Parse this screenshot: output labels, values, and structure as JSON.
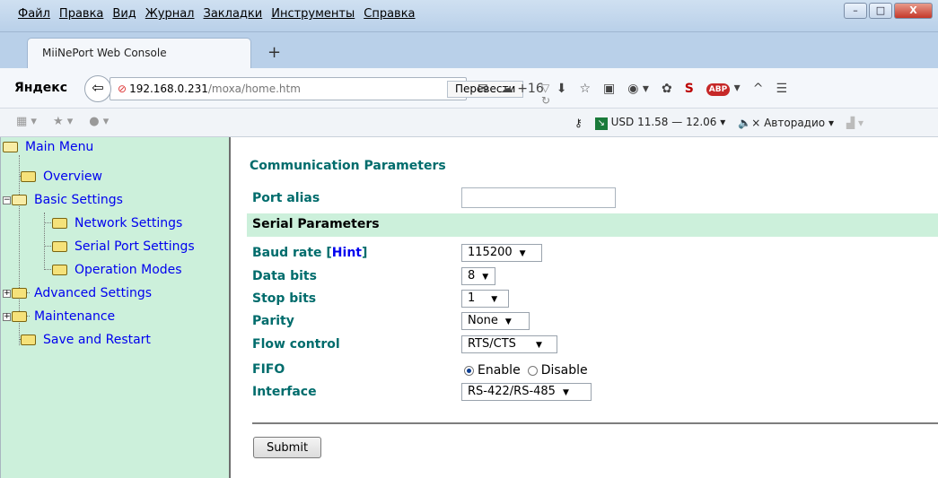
{
  "browser": {
    "menu": [
      "Файл",
      "Правка",
      "Вид",
      "Журнал",
      "Закладки",
      "Инструменты",
      "Справка"
    ],
    "tab_title": "MiiNePort Web Console",
    "new_tab": "+",
    "brand": "Яндекс",
    "url_host": "192.168.0.231",
    "url_path": "/moxa/home.htm",
    "translate_label": "Перевести",
    "weather": "+16",
    "currency": "USD 11.58 — 12.06",
    "radio": "Авторадио",
    "adblock": "ABP",
    "window_min": "–",
    "window_max": "□",
    "window_close": "X"
  },
  "sidebar": {
    "items": [
      {
        "label": "Main Menu"
      },
      {
        "label": "Overview"
      },
      {
        "label": "Basic Settings"
      },
      {
        "label": "Network Settings"
      },
      {
        "label": "Serial Port Settings"
      },
      {
        "label": "Operation Modes"
      },
      {
        "label": "Advanced Settings"
      },
      {
        "label": "Maintenance"
      },
      {
        "label": "Save and Restart"
      }
    ],
    "expand_minus": "−",
    "expand_plus": "+"
  },
  "main": {
    "title": "Communication Parameters",
    "port_alias_label": "Port alias",
    "port_alias_value": "",
    "section_title": "Serial Parameters",
    "baud_label": "Baud rate [",
    "hint_label": "Hint",
    "baud_close": "]",
    "baud_value": "115200",
    "databits_label": "Data bits",
    "databits_value": "8",
    "stopbits_label": "Stop bits",
    "stopbits_value": "1",
    "parity_label": "Parity",
    "parity_value": "None",
    "flow_label": "Flow control",
    "flow_value": "RTS/CTS",
    "fifo_label": "FIFO",
    "fifo_enable": "Enable",
    "fifo_disable": "Disable",
    "interface_label": "Interface",
    "interface_value": "RS-422/RS-485",
    "submit_label": "Submit"
  }
}
